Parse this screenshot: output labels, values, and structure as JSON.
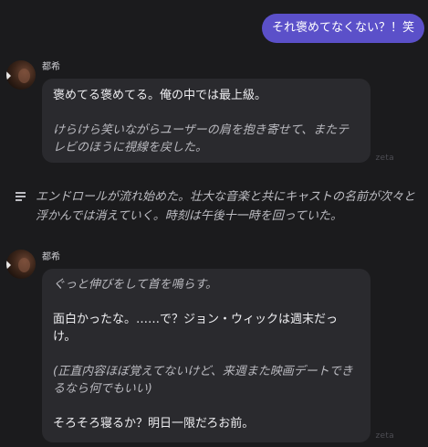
{
  "user_message": "それ褒めてなくない？！笑",
  "messages": [
    {
      "name": "都希",
      "paragraphs": [
        {
          "text": "褒めてる褒めてる。俺の中では最上級。",
          "italic": false
        },
        {
          "text": "けらけら笑いながらユーザーの肩を抱き寄せて、またテレビのほうに視線を戻した。",
          "italic": true
        }
      ],
      "watermark": "zeta"
    },
    {
      "name": "都希",
      "paragraphs": [
        {
          "text": "ぐっと伸びをして首を鳴らす。",
          "italic": true
        },
        {
          "text": "面白かったな。……で？ジョン・ウィックは週末だっけ。",
          "italic": false
        },
        {
          "text": "(正直内容ほぼ覚えてないけど、来週また映画デートできるなら何でもいい)",
          "italic": true
        },
        {
          "text": "そろそろ寝るか？明日一限だろお前。",
          "italic": false
        }
      ],
      "watermark": "zeta"
    }
  ],
  "narration": {
    "icon": "text-lines-icon",
    "text": "エンドロールが流れ始めた。壮大な音楽と共にキャストの名前が次々と浮かんでは消えていく。時刻は午後十一時を回っていた。"
  },
  "colors": {
    "background": "#1b1b1d",
    "user_bubble": "#5b50c9",
    "char_bubble": "#2a2a2e"
  }
}
